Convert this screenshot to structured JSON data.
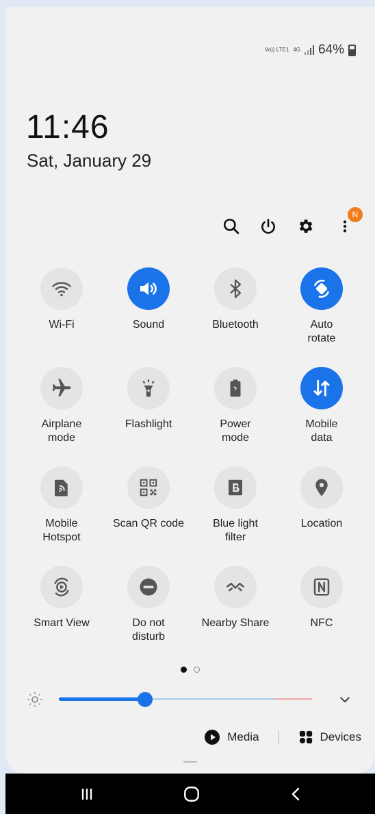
{
  "status_bar": {
    "volte_label": "Vo)) LTE1",
    "network_label": "4G",
    "battery_text": "64%",
    "battery_level": 0.64
  },
  "clock": {
    "time": "11:46",
    "date": "Sat, January 29"
  },
  "header_actions": {
    "icons": [
      "search-icon",
      "power-icon",
      "gear-icon",
      "more-vertical-icon"
    ],
    "notification_badge": "N"
  },
  "tiles": [
    {
      "label": "Wi-Fi",
      "icon": "wifi-icon",
      "active": false
    },
    {
      "label": "Sound",
      "icon": "sound-icon",
      "active": true
    },
    {
      "label": "Bluetooth",
      "icon": "bluetooth-icon",
      "active": false
    },
    {
      "label": "Auto\nrotate",
      "icon": "auto-rotate-icon",
      "active": true
    },
    {
      "label": "Airplane\nmode",
      "icon": "airplane-icon",
      "active": false
    },
    {
      "label": "Flashlight",
      "icon": "flashlight-icon",
      "active": false
    },
    {
      "label": "Power\nmode",
      "icon": "power-mode-icon",
      "active": false
    },
    {
      "label": "Mobile\ndata",
      "icon": "mobile-data-icon",
      "active": true
    },
    {
      "label": "Mobile\nHotspot",
      "icon": "hotspot-icon",
      "active": false
    },
    {
      "label": "Scan QR code",
      "icon": "qr-code-icon",
      "active": false
    },
    {
      "label": "Blue light\nfilter",
      "icon": "blue-light-icon",
      "active": false
    },
    {
      "label": "Location",
      "icon": "location-icon",
      "active": false
    },
    {
      "label": "Smart View",
      "icon": "smart-view-icon",
      "active": false
    },
    {
      "label": "Do not\ndisturb",
      "icon": "do-not-disturb-icon",
      "active": false
    },
    {
      "label": "Nearby Share",
      "icon": "nearby-share-icon",
      "active": false
    },
    {
      "label": "NFC",
      "icon": "nfc-icon",
      "active": false
    }
  ],
  "pager": {
    "current": 1,
    "total": 2
  },
  "brightness": {
    "level": 0.34
  },
  "bottom": {
    "media_label": "Media",
    "devices_label": "Devices"
  },
  "colors": {
    "accent": "#1a73e8",
    "tile_off": "#e4e4e4",
    "badge": "#f07c1a"
  }
}
